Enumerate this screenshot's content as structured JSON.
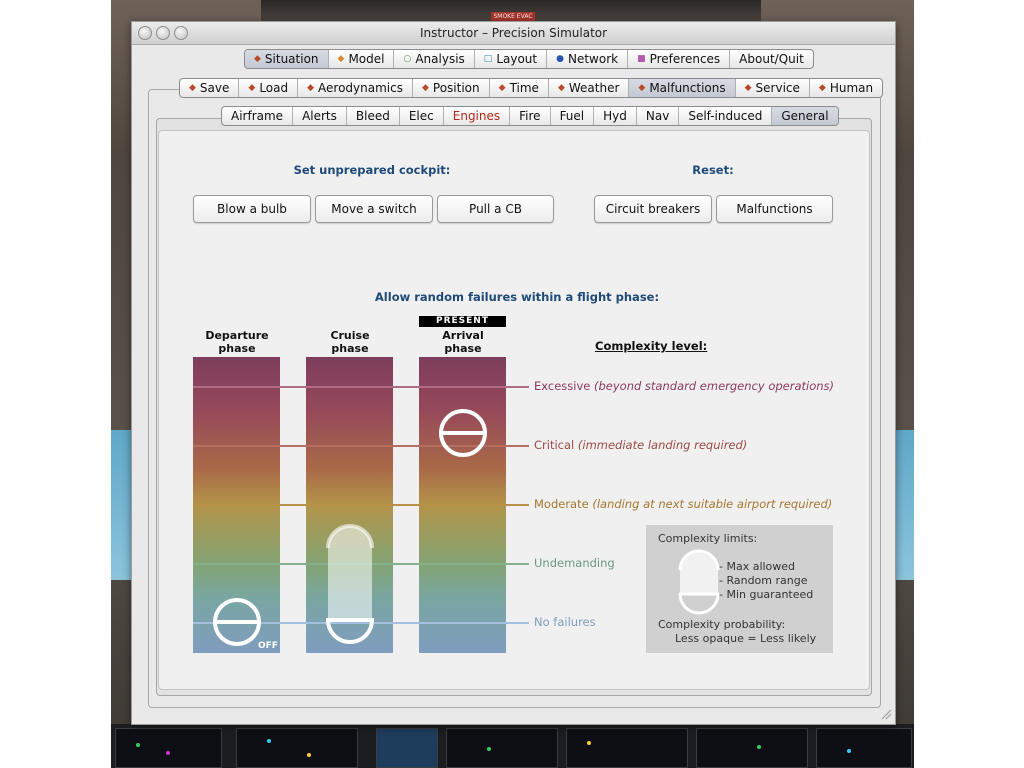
{
  "window": {
    "title": "Instructor – Precision Simulator"
  },
  "background": {
    "smoke_label": "SMOKE EVAC"
  },
  "main_tabs": [
    {
      "label": "Situation",
      "icon": "diamond-icon",
      "color": "#b84a2b",
      "selected": true
    },
    {
      "label": "Model",
      "icon": "diamond-icon",
      "color": "#d58a2e"
    },
    {
      "label": "Analysis",
      "icon": "circle-icon",
      "color": "#4f9a4b"
    },
    {
      "label": "Layout",
      "icon": "square-icon",
      "color": "#3a8fb0"
    },
    {
      "label": "Network",
      "icon": "dot-icon",
      "color": "#2856a8"
    },
    {
      "label": "Preferences",
      "icon": "square-icon",
      "color": "#b55bb0"
    },
    {
      "label": "About/Quit",
      "icon": "",
      "color": ""
    }
  ],
  "situation_tabs": [
    {
      "label": "Save"
    },
    {
      "label": "Load"
    },
    {
      "label": "Aerodynamics"
    },
    {
      "label": "Position"
    },
    {
      "label": "Time"
    },
    {
      "label": "Weather"
    },
    {
      "label": "Malfunctions",
      "selected": true
    },
    {
      "label": "Service"
    },
    {
      "label": "Human"
    }
  ],
  "malfunction_tabs": [
    {
      "label": "Airframe"
    },
    {
      "label": "Alerts"
    },
    {
      "label": "Bleed"
    },
    {
      "label": "Elec"
    },
    {
      "label": "Engines",
      "red": true
    },
    {
      "label": "Fire"
    },
    {
      "label": "Fuel"
    },
    {
      "label": "Hyd"
    },
    {
      "label": "Nav"
    },
    {
      "label": "Self-induced"
    },
    {
      "label": "General",
      "selected": true
    }
  ],
  "cockpit": {
    "heading": "Set unprepared cockpit:",
    "blow_bulb": "Blow a bulb",
    "move_switch": "Move a switch",
    "pull_cb": "Pull a CB"
  },
  "reset": {
    "heading": "Reset:",
    "circuit_breakers": "Circuit breakers",
    "malfunctions": "Malfunctions"
  },
  "failures": {
    "heading": "Allow random failures within a flight phase:",
    "present_badge": "PRESENT",
    "phases": [
      {
        "label_line1": "Departure",
        "label_line2": "phase"
      },
      {
        "label_line1": "Cruise",
        "label_line2": "phase"
      },
      {
        "label_line1": "Arrival",
        "label_line2": "phase"
      }
    ],
    "off_label": "OFF",
    "complexity_title": "Complexity level:",
    "levels": [
      {
        "name": "Excessive",
        "note": "(beyond standard emergency operations)",
        "color": "#8b3a5c"
      },
      {
        "name": "Critical",
        "note": "(immediate landing required)",
        "color": "#9a4a45"
      },
      {
        "name": "Moderate",
        "note": "(landing at next suitable airport required)",
        "color": "#a5762f"
      },
      {
        "name": "Undemanding",
        "note": "",
        "color": "#6a9a7d"
      },
      {
        "name": "No failures",
        "note": "",
        "color": "#7f9dbf"
      }
    ]
  },
  "legend": {
    "title": "Complexity limits:",
    "max_allowed": "- Max allowed",
    "random_range": "- Random range",
    "min_guaranteed": "- Min guaranteed",
    "probability_title": "Complexity probability:",
    "probability_note": "Less opaque = Less likely"
  }
}
